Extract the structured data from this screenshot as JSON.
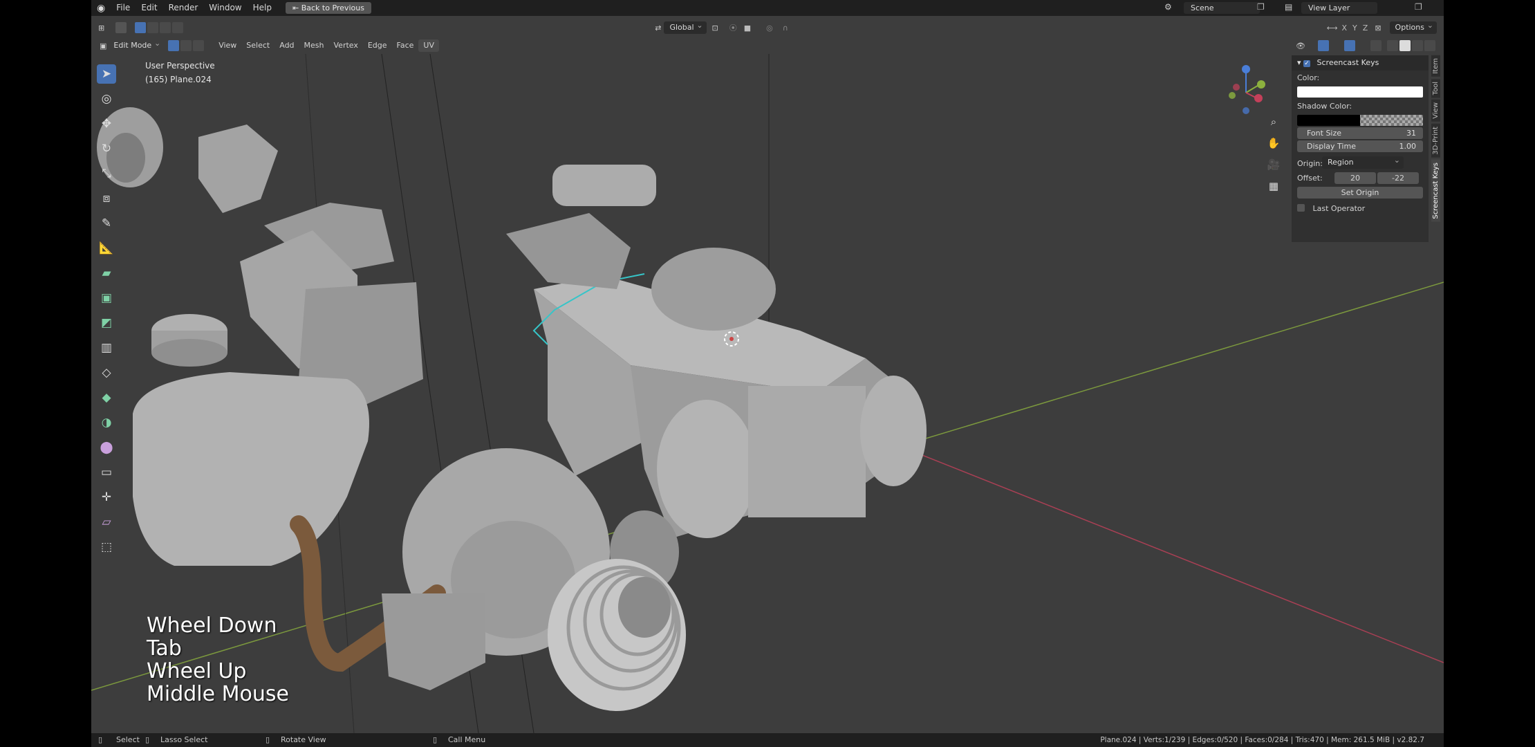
{
  "topbar": {
    "menus": [
      "File",
      "Edit",
      "Render",
      "Window",
      "Help"
    ],
    "back_button": "Back to Previous",
    "scene": "Scene",
    "view_layer": "View Layer"
  },
  "header2": {
    "orientation": "Global",
    "options": "Options",
    "axes": [
      "X",
      "Y",
      "Z"
    ]
  },
  "header3": {
    "mode": "Edit Mode",
    "menus": [
      "View",
      "Select",
      "Add",
      "Mesh",
      "Vertex",
      "Edge",
      "Face",
      "UV"
    ]
  },
  "viewport": {
    "perspective": "User Perspective",
    "object": "(165) Plane.024"
  },
  "screencast": {
    "lines": [
      "Wheel Down",
      "Tab",
      "Wheel Up",
      "Middle Mouse"
    ]
  },
  "npanel": {
    "title": "Screencast Keys",
    "color_label": "Color:",
    "shadow_label": "Shadow Color:",
    "font_size_label": "Font Size",
    "font_size_value": "31",
    "display_time_label": "Display Time",
    "display_time_value": "1.00",
    "origin_label": "Origin:",
    "origin_value": "Region",
    "offset_label": "Offset:",
    "offset_x": "20",
    "offset_y": "-22",
    "set_origin": "Set Origin",
    "last_operator": "Last Operator",
    "color_value": "#ffffff",
    "shadow_value": "#000000"
  },
  "sidetabs": [
    "Item",
    "Tool",
    "View",
    "3D-Print",
    "Screencast Keys"
  ],
  "statusbar": {
    "select": "Select",
    "lasso": "Lasso Select",
    "rotate": "Rotate View",
    "call_menu": "Call Menu",
    "stats": "Plane.024 | Verts:1/239 | Edges:0/520 | Faces:0/284 | Tris:470 | Mem: 261.5 MiB | v2.82.7"
  },
  "colors": {
    "accent": "#4772b3",
    "x_axis": "#c4405a",
    "y_axis": "#8cb13e",
    "z_axis": "#4a7ed8",
    "selection": "#36c5c8",
    "exhaust": "#7b5a3c"
  }
}
